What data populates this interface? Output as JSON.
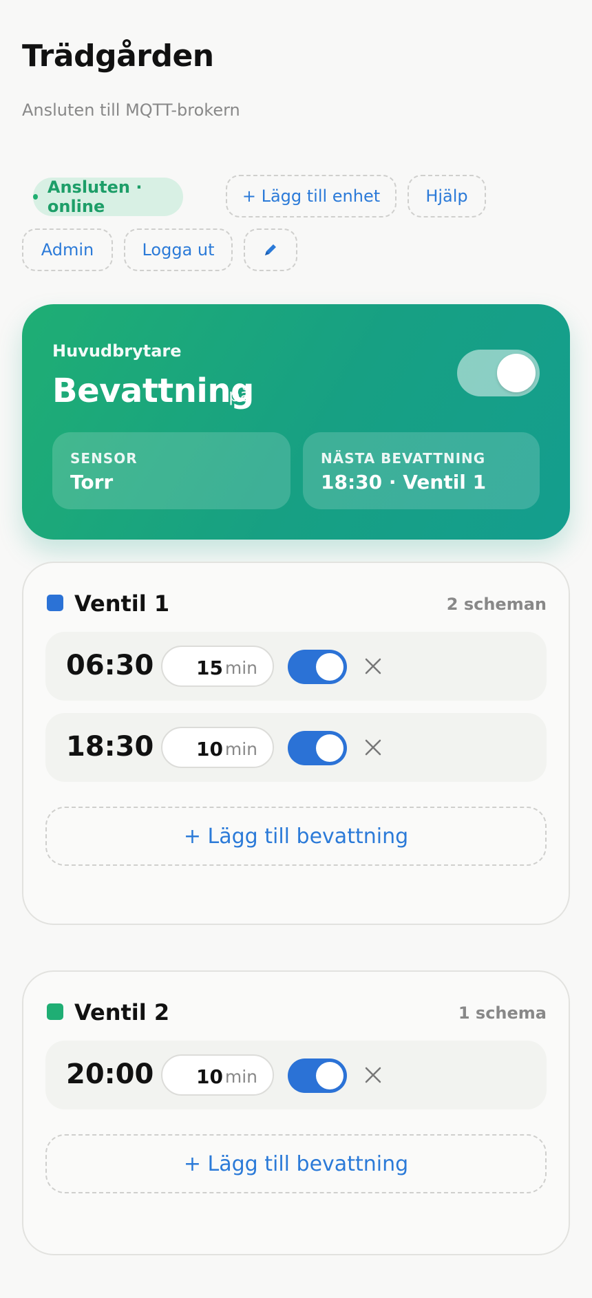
{
  "header": {
    "title": "Trädgården",
    "subtitle": "Ansluten till MQTT-brokern"
  },
  "toolbar": {
    "status": "Ansluten · online",
    "add_device": "+ Lägg till enhet",
    "help": "Hjälp",
    "admin": "Admin",
    "logout": "Logga ut",
    "edit_icon": "pencil-icon"
  },
  "master": {
    "label": "Huvudbrytare",
    "title": "Bevattning",
    "state": "på",
    "enabled": true,
    "sensor_label": "SENSOR",
    "sensor_value": "Torr",
    "next_label": "NÄSTA BEVATTNING",
    "next_value": "18:30 · Ventil 1"
  },
  "valves": [
    {
      "name": "Ventil 1",
      "color": "#2b72d6",
      "count_label": "2 scheman",
      "schedules": [
        {
          "time": "06:30",
          "minutes": "15",
          "unit": "min",
          "enabled": true
        },
        {
          "time": "18:30",
          "minutes": "10",
          "unit": "min",
          "enabled": true
        }
      ],
      "add_label": "+ Lägg till bevattning"
    },
    {
      "name": "Ventil 2",
      "color": "#1fae74",
      "count_label": "1 schema",
      "schedules": [
        {
          "time": "20:00",
          "minutes": "10",
          "unit": "min",
          "enabled": true
        }
      ],
      "add_label": "+ Lägg till bevattning"
    }
  ],
  "colors": {
    "accent": "#2b7ad8",
    "success": "#1fae70",
    "hero_start": "#1fae74",
    "hero_end": "#149e8e"
  }
}
